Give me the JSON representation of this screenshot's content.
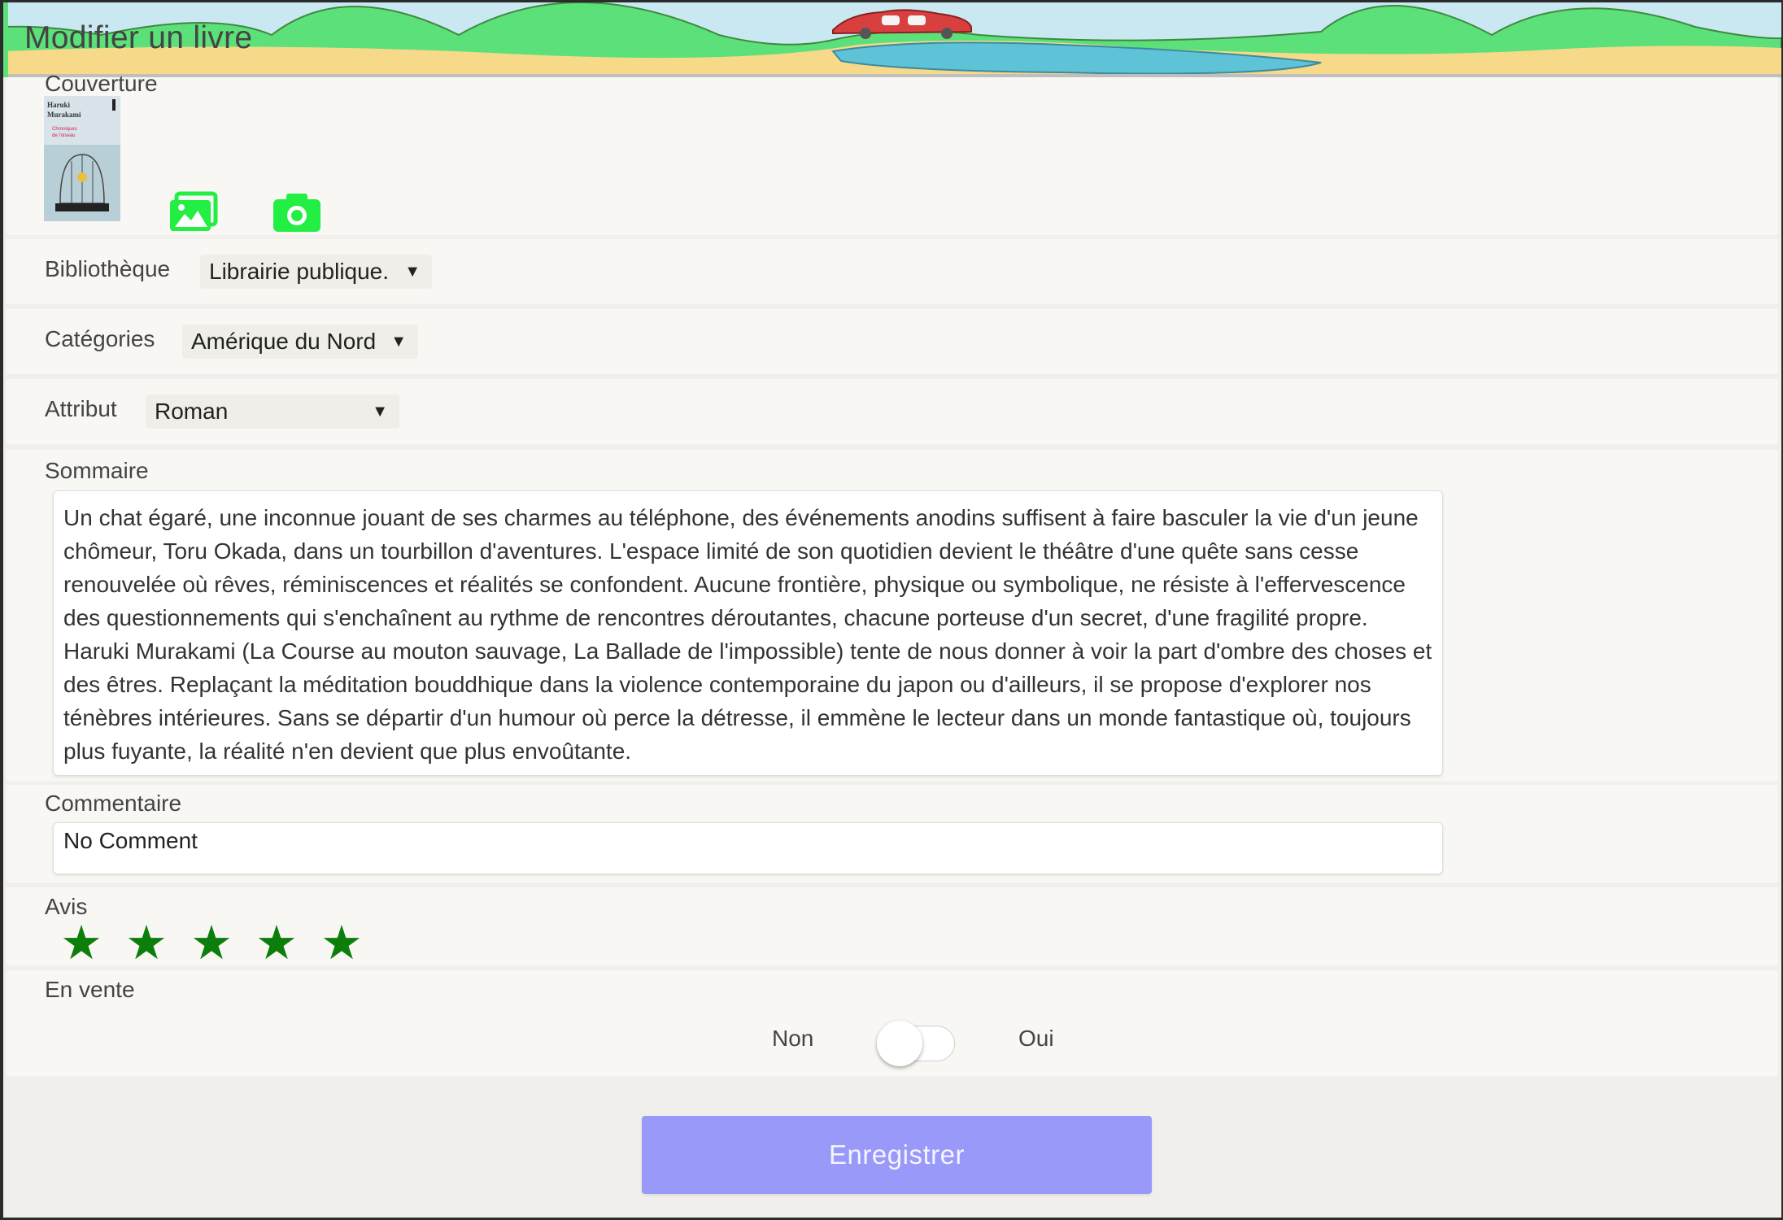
{
  "header": {
    "title": "Modifier un livre"
  },
  "cover": {
    "label": "Couverture",
    "book_author": "Haruki Murakami",
    "gallery_icon": "image-gallery-icon",
    "camera_icon": "camera-icon"
  },
  "library": {
    "label": "Bibliothèque",
    "selected": "Librairie publique."
  },
  "categories": {
    "label": "Catégories",
    "selected": "Amérique du Nord"
  },
  "attribute": {
    "label": "Attribut",
    "selected": "Roman"
  },
  "summary": {
    "label": "Sommaire",
    "text": "Un chat égaré, une inconnue jouant de ses charmes au téléphone, des événements anodins suffisent à faire basculer la vie d'un jeune chômeur, Toru Okada, dans un tourbillon d'aventures. L'espace limité de son quotidien devient le théâtre d'une quête sans cesse renouvelée où rêves, réminiscences et réalités se confondent. Aucune frontière, physique ou symbolique, ne résiste à l'effervescence des questionnements qui s'enchaînent au rythme de rencontres déroutantes, chacune porteuse d'un secret, d'une fragilité propre. Haruki Murakami (La Course au mouton sauvage, La Ballade de l'impossible) tente de nous donner à voir la part d'ombre des choses et des êtres. Replaçant la méditation bouddhique dans la violence contemporaine du japon ou d'ailleurs, il se propose d'explorer nos ténèbres intérieures. Sans se départir d'un humour où perce la détresse, il emmène le lecteur dans un monde fantastique où, toujours plus fuyante, la réalité n'en devient que plus envoûtante."
  },
  "comment": {
    "label": "Commentaire",
    "value": "No Comment"
  },
  "rating": {
    "label": "Avis",
    "value": 5,
    "max": 5,
    "star_icon": "star-icon",
    "color": "#0b7e0b"
  },
  "sale": {
    "label": "En vente",
    "off_label": "Non",
    "on_label": "Oui",
    "enabled": false
  },
  "save_button": {
    "label": "Enregistrer",
    "color": "#9999f9"
  },
  "colors": {
    "accent_green": "#22ee44",
    "background": "#f8f7f4"
  }
}
